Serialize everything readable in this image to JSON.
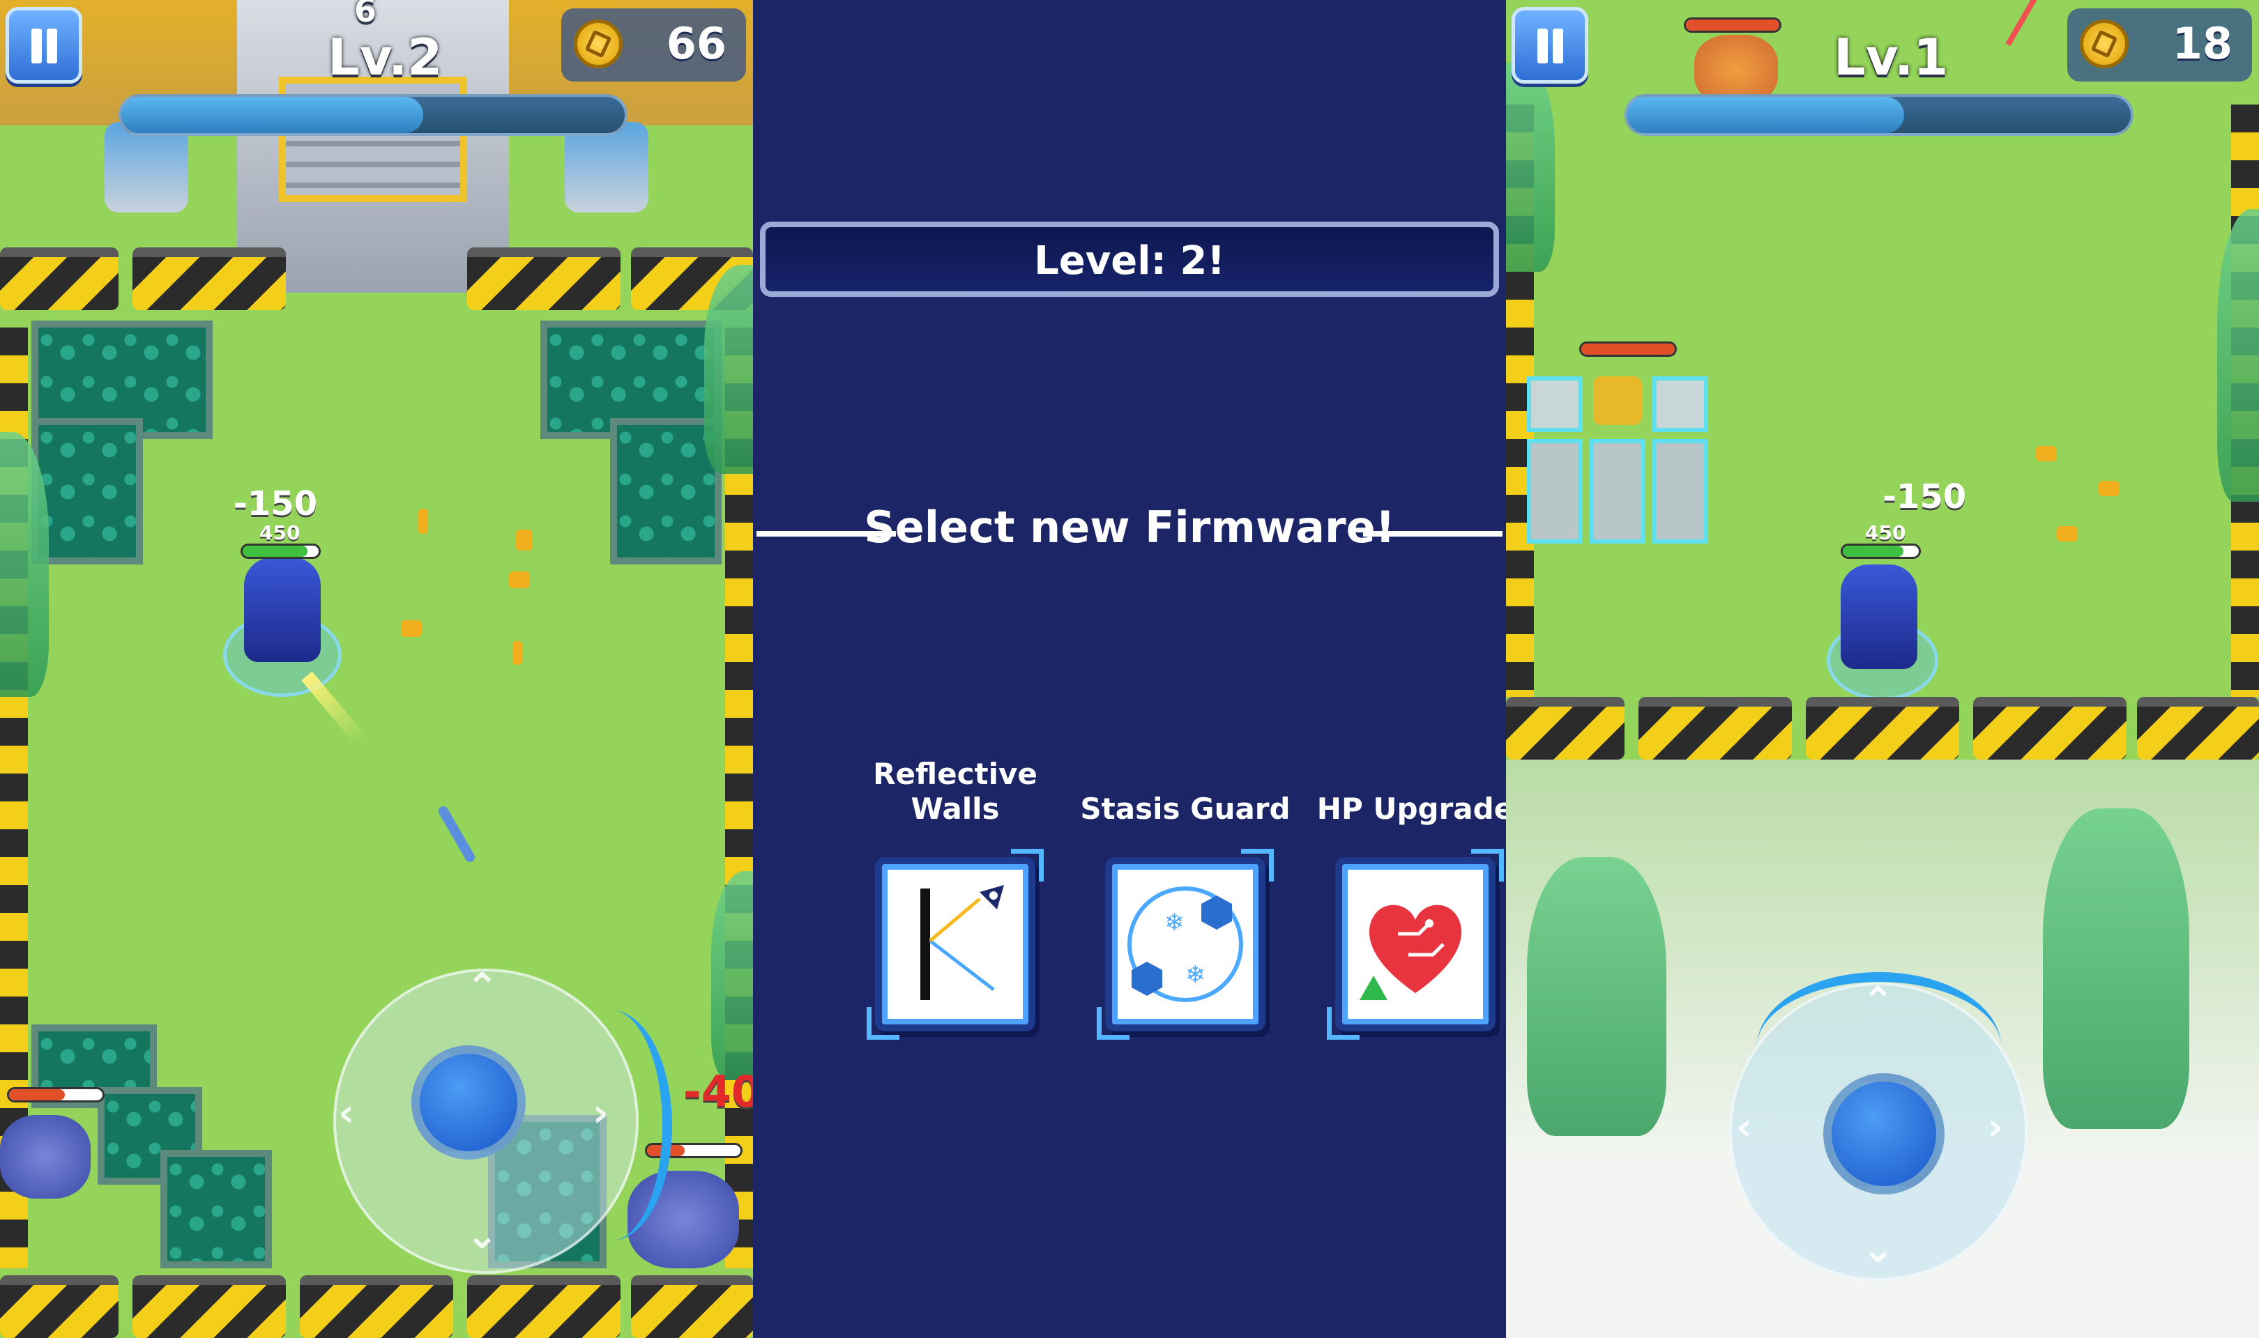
{
  "left_panel": {
    "level_label": "Lv.2",
    "level_top_number": "6",
    "coins": "66",
    "player": {
      "damage_text": "-150",
      "hp_text": "450",
      "hp_fraction": 0.85
    },
    "enemy_damage_text": "-40",
    "xp_fraction": 0.6
  },
  "firmware_screen": {
    "level_banner": "Level: 2!",
    "heading": "Select new Firmware!",
    "options": [
      {
        "label": "Reflective Walls",
        "icon": "reflective-walls-icon"
      },
      {
        "label": "Stasis Guard",
        "icon": "stasis-guard-icon"
      },
      {
        "label": "HP Upgrade",
        "icon": "hp-upgrade-icon"
      }
    ]
  },
  "right_panel": {
    "level_label": "Lv.1",
    "coins": "18",
    "player": {
      "damage_text": "-150",
      "hp_text": "450",
      "hp_fraction": 0.8
    },
    "xp_fraction": 0.55
  },
  "colors": {
    "accent_blue": "#2f6fd6",
    "hazard_yellow": "#f4cf1a",
    "grass": "#95d45a",
    "overlay_navy": "#1c2566",
    "hp_green": "#3fbf3f",
    "enemy_red": "#e2502a"
  }
}
